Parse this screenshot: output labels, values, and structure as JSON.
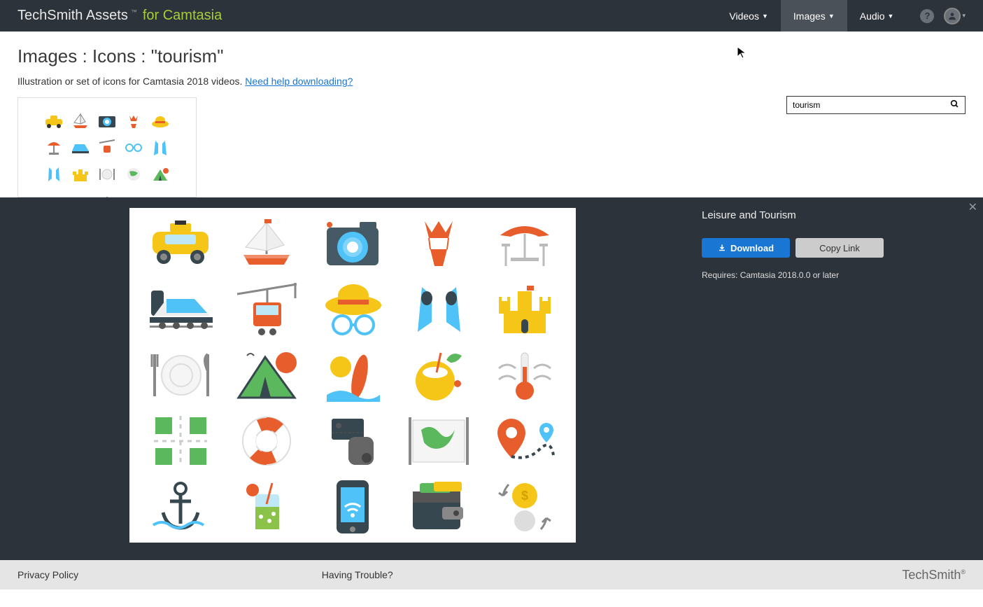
{
  "header": {
    "brand_main": "TechSmith Assets",
    "brand_tm": "™",
    "brand_for": "for Camtasia",
    "nav": [
      {
        "label": "Videos",
        "active": false
      },
      {
        "label": "Images",
        "active": true
      },
      {
        "label": "Audio",
        "active": false
      }
    ],
    "help_glyph": "?"
  },
  "page": {
    "title": "Images : Icons : \"tourism\"",
    "subtitle": "Illustration or set of icons for Camtasia 2018 videos. ",
    "help_link": "Need help downloading?"
  },
  "search": {
    "value": "tourism"
  },
  "asset": {
    "title": "Leisure and Tourism",
    "download_label": "Download",
    "copy_label": "Copy Link",
    "requires": "Requires: Camtasia 2018.0.0 or later"
  },
  "icons": {
    "names": [
      "taxi",
      "sailboat",
      "camera",
      "bikini",
      "cafe-umbrella",
      "train",
      "cable-car",
      "hat-glasses",
      "fins",
      "sandcastle",
      "dining",
      "tent",
      "surfboard",
      "coconut-drink",
      "thermometer",
      "crossroads",
      "lifebuoy",
      "tickets",
      "world-map",
      "route-pin",
      "anchor",
      "cocktail",
      "smartphone-wifi",
      "wallet",
      "currency-exchange"
    ]
  },
  "footer": {
    "privacy": "Privacy Policy",
    "trouble": "Having Trouble?",
    "brand": "TechSmith"
  }
}
